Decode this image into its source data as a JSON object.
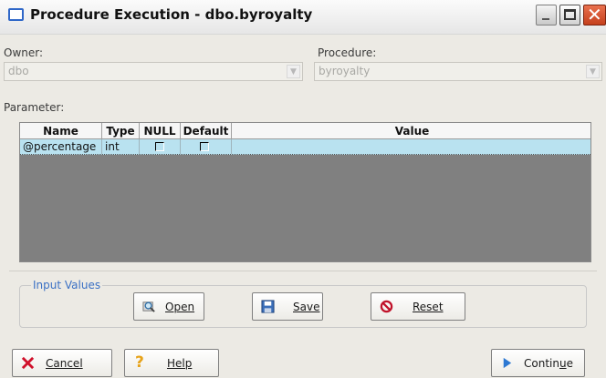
{
  "window": {
    "title": "Procedure Execution - dbo.byroyalty"
  },
  "owner": {
    "label": "Owner:",
    "value": "dbo"
  },
  "procedure": {
    "label": "Procedure:",
    "value": "byroyalty"
  },
  "parameter": {
    "label": "Parameter:",
    "columns": [
      "Name",
      "Type",
      "NULL",
      "Default",
      "Value"
    ],
    "rows": [
      {
        "name": "@percentage",
        "type": "int",
        "null": false,
        "default": false,
        "value": ""
      }
    ]
  },
  "input_values": {
    "title": "Input Values",
    "open_label": "Open",
    "save_label": "Save",
    "reset_label": "Reset"
  },
  "footer": {
    "cancel_label": "Cancel",
    "help_label": "Help",
    "continue_prefix": "Contin",
    "continue_mnemonic": "u",
    "continue_suffix": "e"
  },
  "colors": {
    "selected_row": "#b9e2f0",
    "grid_background": "#808080",
    "group_title": "#3a70c4"
  }
}
